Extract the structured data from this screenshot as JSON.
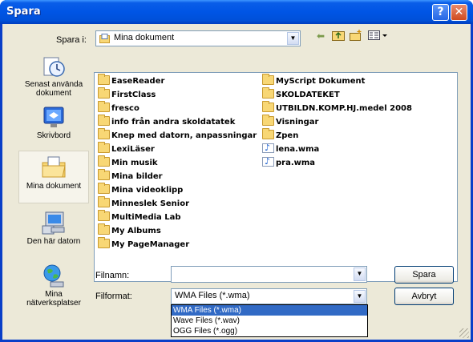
{
  "window": {
    "title": "Spara"
  },
  "toolbar": {
    "save_in_label": "Spara i:",
    "location": "Mina dokument"
  },
  "places": [
    {
      "label": "Senast använda dokument",
      "icon": "recent-documents-icon"
    },
    {
      "label": "Skrivbord",
      "icon": "desktop-icon"
    },
    {
      "label": "Mina dokument",
      "icon": "my-documents-icon",
      "selected": true
    },
    {
      "label": "Den här datorn",
      "icon": "my-computer-icon"
    },
    {
      "label": "Mina nätverksplatser",
      "icon": "network-places-icon"
    }
  ],
  "files": {
    "col1": [
      {
        "name": "EaseReader",
        "type": "folder"
      },
      {
        "name": "FirstClass",
        "type": "folder"
      },
      {
        "name": "fresco",
        "type": "folder"
      },
      {
        "name": "info från andra skoldatatek",
        "type": "folder"
      },
      {
        "name": "Knep med datorn, anpassningar",
        "type": "folder"
      },
      {
        "name": "LexiLäser",
        "type": "folder"
      },
      {
        "name": "Min musik",
        "type": "folder"
      },
      {
        "name": "Mina bilder",
        "type": "folder"
      },
      {
        "name": "Mina videoklipp",
        "type": "folder"
      },
      {
        "name": "Minneslek Senior",
        "type": "folder"
      },
      {
        "name": "MultiMedia Lab",
        "type": "folder"
      },
      {
        "name": "My Albums",
        "type": "folder"
      },
      {
        "name": "My PageManager",
        "type": "folder"
      }
    ],
    "col2": [
      {
        "name": "MyScript Dokument",
        "type": "folder"
      },
      {
        "name": "SKOLDATEKET",
        "type": "folder"
      },
      {
        "name": "UTBILDN.KOMP.HJ.medel 2008",
        "type": "folder"
      },
      {
        "name": "Visningar",
        "type": "folder"
      },
      {
        "name": "Zpen",
        "type": "folder"
      },
      {
        "name": "lena.wma",
        "type": "audio"
      },
      {
        "name": "pra.wma",
        "type": "audio"
      }
    ]
  },
  "form": {
    "filename_label": "Filnamn:",
    "filename_value": "",
    "format_label": "Filformat:",
    "format_value": "WMA Files (*.wma)",
    "format_options": [
      "WMA Files (*.wma)",
      "Wave Files (*.wav)",
      "OGG Files (*.ogg)"
    ]
  },
  "buttons": {
    "save": "Spara",
    "cancel": "Avbryt"
  }
}
